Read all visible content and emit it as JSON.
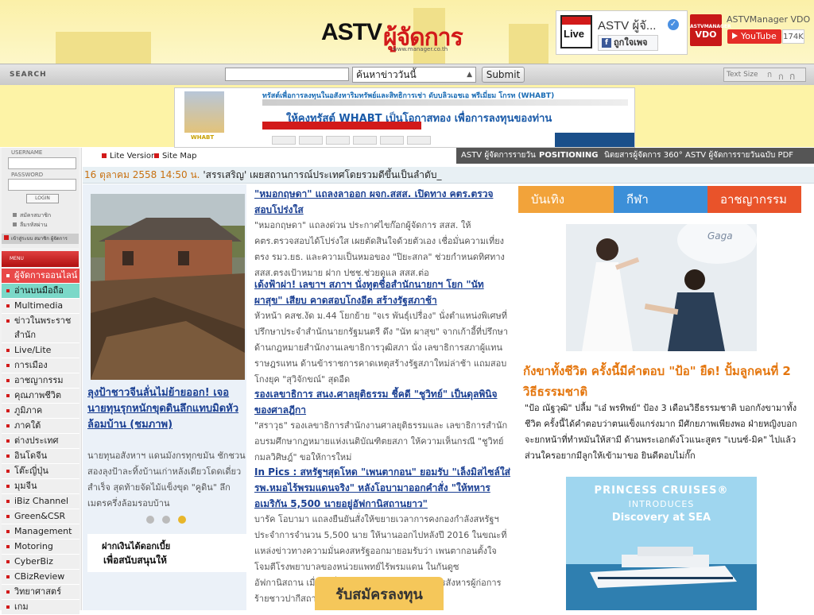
{
  "header": {
    "logo_text": "ASTV",
    "logo_thai": "ผู้จัดการ",
    "logo_url": "www.manager.co.th",
    "fb_live": "Live",
    "fb_name": "ASTV ผู้จั...",
    "fb_like": "ถูกใจเพจ",
    "vdo_small": "ASTVMANAGER",
    "vdo_big": "VDO",
    "vdo_channel": "ASTVManager VDO",
    "youtube_label": "YouTube",
    "youtube_count": "174K"
  },
  "search": {
    "label": "SEARCH",
    "input_value": "",
    "select_value": "ค้นหาข่าววันนี้",
    "submit_label": "Submit",
    "text_size_label": "Text Size",
    "size_a1": "ก",
    "size_a2": "ก",
    "size_a3": "ก"
  },
  "banner_ad": {
    "line1": "ทรัสต์เพื่อการลงทุนในอสังหาริมทรัพย์และสิทธิการเช่า ดับบลิวเอชเอ พรีเมี่ยม โกรท (WHABT)",
    "line3": "ให้คงทรัสต์ WHABT เป็นโอกาสทอง เพื่อการลงทุนของท่าน",
    "brand": "WHABT"
  },
  "sidebar": {
    "username_label": "USERNAME",
    "password_label": "PASSWORD",
    "login_label": "LOGIN",
    "register_label": "สมัครสมาชิก",
    "forgot_label": "ลืมรหัสผ่าน",
    "favorite_label": "เข้าสู่ระบบ สมาชิก ผู้จัดการ",
    "menu_label": "MENU",
    "items": [
      {
        "label": "ผู้จัดการออนไลน์"
      },
      {
        "label": "อ่านบนมือถือ"
      },
      {
        "label": "Multimedia"
      },
      {
        "label": "ข่าวในพระราชสำนัก"
      },
      {
        "label": "Live/Lite"
      },
      {
        "label": "การเมือง"
      },
      {
        "label": "อาชญากรรม"
      },
      {
        "label": "คุณภาพชีวิต"
      },
      {
        "label": "ภูมิภาค"
      },
      {
        "label": "ภาคใต้"
      },
      {
        "label": "ต่างประเทศ"
      },
      {
        "label": "อินโดจีน"
      },
      {
        "label": "โต๊ะญี่ปุ่น"
      },
      {
        "label": "มุมจีน"
      },
      {
        "label": "iBiz Channel"
      },
      {
        "label": "Green&CSR"
      },
      {
        "label": "Management"
      },
      {
        "label": "Motoring"
      },
      {
        "label": "CyberBiz"
      },
      {
        "label": "CBizReview"
      },
      {
        "label": "วิทยาศาสตร์"
      },
      {
        "label": "เกม"
      }
    ]
  },
  "topnav": {
    "lite_version": "Lite Version",
    "site_map": "Site Map",
    "items": [
      "ASTV ผู้จัดการรายวัน",
      "POSITIONING",
      "นิตยสารผู้จัดการ 360°",
      "ASTV ผู้จัดการรายวันฉบับ PDF"
    ]
  },
  "ticker": {
    "date": "16 ตุลาคม 2558 14:50 น.",
    "headline": "'สรรเสริญ' เผยสถานการณ์ประเทศโดยรวมดีขึ้นเป็นลำดับ_"
  },
  "left_feature": {
    "caption": "ลุงป้าชาวจีนลั่นไม่ย้ายออก! เจอนายทุนรุกหนักขุดดินลึกแทบมิดหัวล้อมบ้าน (ชมภาพ)",
    "summary": "นายทุนอสังหาฯ แดนมังกรทุกขมัน ชักชวนสองลุงป้าละทิ้งบ้านเก่าหลังเดียวโดดเดี่ยวสำเร็จ สุดท้ายจัดไม้แข็งขุด \"คูดิน\" ลึกเมตรครึ่งล้อมรอบบ้าน",
    "ad_line1": "ฝากเงินได้ดอกเบี้ย",
    "ad_line2": "เพื่อสนับสนุนให้"
  },
  "articles": [
    {
      "headline": "\"หมอกฤษดา\" แถลงลาออก ผจก.สสส. เปิดทาง คตร.ตรวจสอบโปร่งใส",
      "body": "\"หมอกฤษดา\" แถลงด่วน ประกาศไขก๊อกผู้จัดการ สสส. ให้ คตร.ตรวจสอบได้โปร่งใส เผยตัดสินใจด้วยตัวเอง เชื่อมั่นความเที่ยงตรง รมว.ยธ. และความเป็นหมอของ \"ปิยะสกล\" ช่วยกำหนดทิศทาง สสส.ตรงเป้าหมาย ฝาก ปชช.ช่วยดูแล สสส.ต่อ"
    },
    {
      "headline": "เด้งฟ้าผ่า! เลขาฯ สภาฯ นั่งทูตชื่อสำนักนายกฯ โยก \"นัท ผาสุข\" เสียบ คาดสอบโกงอีด สร้างรัฐสภาช้า",
      "body": "หัวหน้า คสช.งัด ม.44 โยกย้าย \"จเร พันธุ์เปรื่อง\" นั่งตำแหน่งพิเศษที่ปรึกษาประจำสำนักนายกรัฐมนตรี ดึง \"นัท ผาสุข\" จากเก้าอี้ที่ปรึกษาด้านกฎหมายสำนักงานเลขาธิการวุฒิสภา นั่ง เลขาธิการสภาผู้แทนราษฎรแทน ด้านข้าราชการคาดเหตุสร้างรัฐสภาใหม่ล่าช้า แถมสอบโกงยุค \"สุวิจักขณ์\" สุดอืด"
    },
    {
      "headline": "รองเลขาธิการ สนง.ศาลยุติธรรม ชี้คดี \"ชูวิทย์\" เป็นดุลพินิจของศาลฎีกา",
      "body": "\"สราวุธ\" รองเลขาธิการสำนักงานศาลยุติธรรมและ เลขาธิการสำนักอบรมศึกษากฎหมายแห่งเนติบัณฑิตยสภา ให้ความเห็นกรณี \"ชูวิทย์ กมลวิศิษฎ์\" ขอให้การใหม่"
    },
    {
      "headline": "In Pics : สหรัฐฯสุดโหด \"เพนตากอน\" ยอมรับ \"เล็งมิสไซล์ใส่รพ.หมอไร้พรมแดนจริง\" หลังโอบามาออกคำสั่ง \"ให้ทหารอเมริกัน 5,500 นายอยู่อัฟกานิสถานยาว\"",
      "body": "บารัค โอบามา แถลงยืนยันสั่งให้ขยายเวลาการคงกองกำลังสหรัฐฯ ประจำการจำนวน 5,500 นาย ให้นานออกไปหลังปี 2016 ในขณะที่แหล่งข่าวทางความมั่นคงสหรัฐออกมายอมรับว่า เพนตากอนตั้งใจโจมตีโรงพยาบาลของหน่วยแพทย์ไร้พรมแดน ในกันดูซ อัฟกานิสถาน เมื่อวันที่ 3 ตุลาคมจริง เพราะต้องการสังหารผู้ก่อการร้ายชาวปากีสถาน"
    }
  ],
  "mid_ad_text": "รับสมัครลงทุน",
  "right_panel": {
    "tabs": [
      "บันเทิง",
      "กีฬา",
      "อาชญากรรม"
    ],
    "headline": "กังขาทั้งชีวิต ครั้งนี้มีคำตอบ \"ป้อ\" ยืด! ปั้มลูกคนที่ 2 วิธีธรรมชาติ",
    "body": "\"ป้อ ณัฐวุฒิ\" ปลื้ม \"เอ๋ พรทิพย์\" ป้อง 3 เดือนวิธีธรรมชาติ บอกกังขามาทั้งชีวิต ครั้งนี้ได้คำตอบว่าตนแข็งแกร่งมาก มีศักยภาพเพียงพอ ฝ่ายหญิงบอกจะยกหน้าที่ทำหมันให้สามี ด้านพระเอกดังโวแนะสูตร \"เบนซ์-มิค\" ไปแล้ว ส่วนใครอยากมีลูกให้เข้ามาขอ ยินดีตอบไม่กั๊ก",
    "photo_brand": "Gaga",
    "cruise_line1": "PRINCESS CRUISES®",
    "cruise_line2": "INTRODUCES",
    "cruise_line3": "Discovery at SEA"
  },
  "colors": {
    "header_bg": "#fdf3a6",
    "accent_red": "#d21a1a",
    "link_blue": "#1a3f92",
    "orange_headline": "#e4760e"
  }
}
